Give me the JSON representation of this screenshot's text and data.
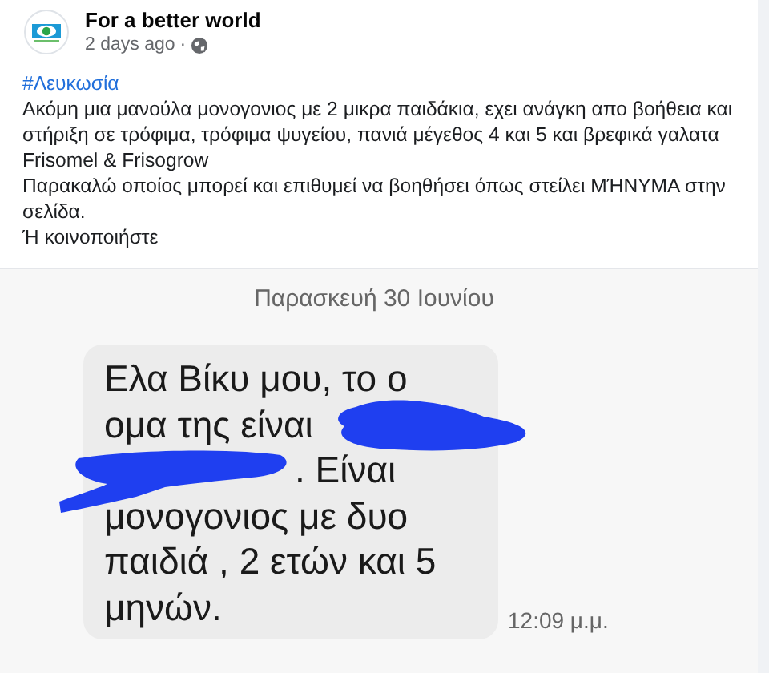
{
  "post": {
    "author": "For a better world",
    "time": "2 days ago",
    "separator": "·",
    "hashtag": "#Λευκωσία",
    "paragraphs": [
      "Ακόμη μια μανούλα μονογονιος με 2 μικρα παιδάκια, εχει ανάγκη απο βοήθεια και στήριξη σε τρόφιμα, τρόφιμα ψυγείου, πανιά μέγεθος 4 και 5 και βρεφικά γαλατα Frisomel & Frisogrow",
      "Παρακαλώ οποίος μπορεί και επιθυμεί να βοηθήσει όπως στείλει ΜΉΝΥΜΑ στην σελίδα.",
      "Ή κοινοποιήστε"
    ]
  },
  "screenshot": {
    "date": "Παρασκευή 30 Ιουνίου",
    "message": {
      "lines": [
        "Ελα Βίκυ μου, το ο",
        "ομα της είναι",
        ". Είναι",
        "μονογονιος με δυο",
        "παιδιά , 2 ετών και 5",
        "μηνών."
      ],
      "time": "12:09 μ.μ."
    }
  }
}
